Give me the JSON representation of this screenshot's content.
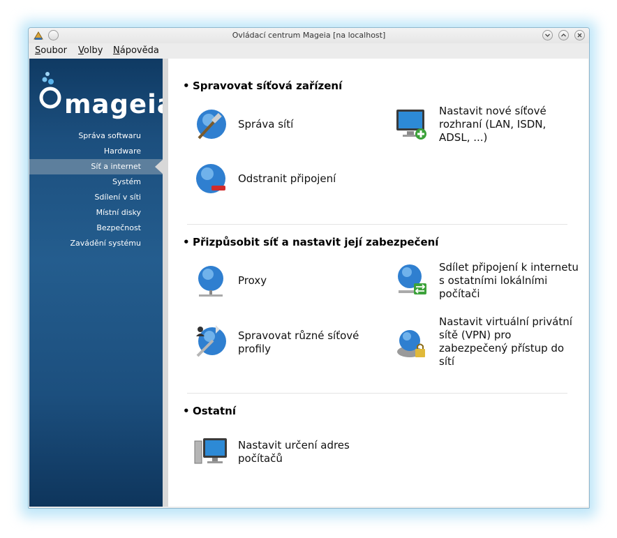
{
  "window": {
    "title": "Ovládací centrum Mageia  [na localhost]",
    "buttons": [
      "minimize",
      "maximize",
      "close"
    ]
  },
  "menubar": {
    "items": [
      {
        "label": "Soubor",
        "accel": "S",
        "rest": "oubor"
      },
      {
        "label": "Volby",
        "accel": "V",
        "rest": "olby"
      },
      {
        "label": "Nápověda",
        "accel": "N",
        "rest": "ápověda"
      }
    ]
  },
  "sidebar": {
    "logo_text": "mageia",
    "items": [
      {
        "label": "Správa softwaru"
      },
      {
        "label": "Hardware"
      },
      {
        "label": "Síť a internet",
        "active": true
      },
      {
        "label": "Systém"
      },
      {
        "label": "Sdílení v síti"
      },
      {
        "label": "Místní disky"
      },
      {
        "label": "Bezpečnost"
      },
      {
        "label": "Zavádění systému"
      }
    ]
  },
  "sections": [
    {
      "title": "Spravovat síťová zařízení",
      "tools": [
        {
          "label": "Správa sítí",
          "icon": "globe-hammer-icon"
        },
        {
          "label": "Nastavit nové síťové rozhraní (LAN, ISDN, ADSL, ...)",
          "icon": "monitor-add-icon"
        },
        {
          "label": "Odstranit připojení",
          "icon": "globe-remove-icon"
        }
      ]
    },
    {
      "title": "Přizpůsobit síť a nastavit její zabezpečení",
      "tools": [
        {
          "label": "Proxy",
          "icon": "globe-network-icon"
        },
        {
          "label": "Sdílet připojení k internetu s ostatními lokálními počítači",
          "icon": "globe-share-icon"
        },
        {
          "label": "Spravovat různé síťové profily",
          "icon": "globe-profiles-icon"
        },
        {
          "label": "Nastavit virtuální privátní sítě (VPN) pro zabezpečený přístup do sítí",
          "icon": "globe-vpn-lock-icon"
        }
      ]
    },
    {
      "title": "Ostatní",
      "tools": [
        {
          "label": "Nastavit určení adres počítačů",
          "icon": "computer-hosts-icon"
        }
      ]
    }
  ],
  "colors": {
    "sidebar_top": "#0f3a63",
    "sidebar_mid": "#245d8e",
    "sidebar_active": "#5d7f9d",
    "window_border": "#8fb7cd"
  }
}
